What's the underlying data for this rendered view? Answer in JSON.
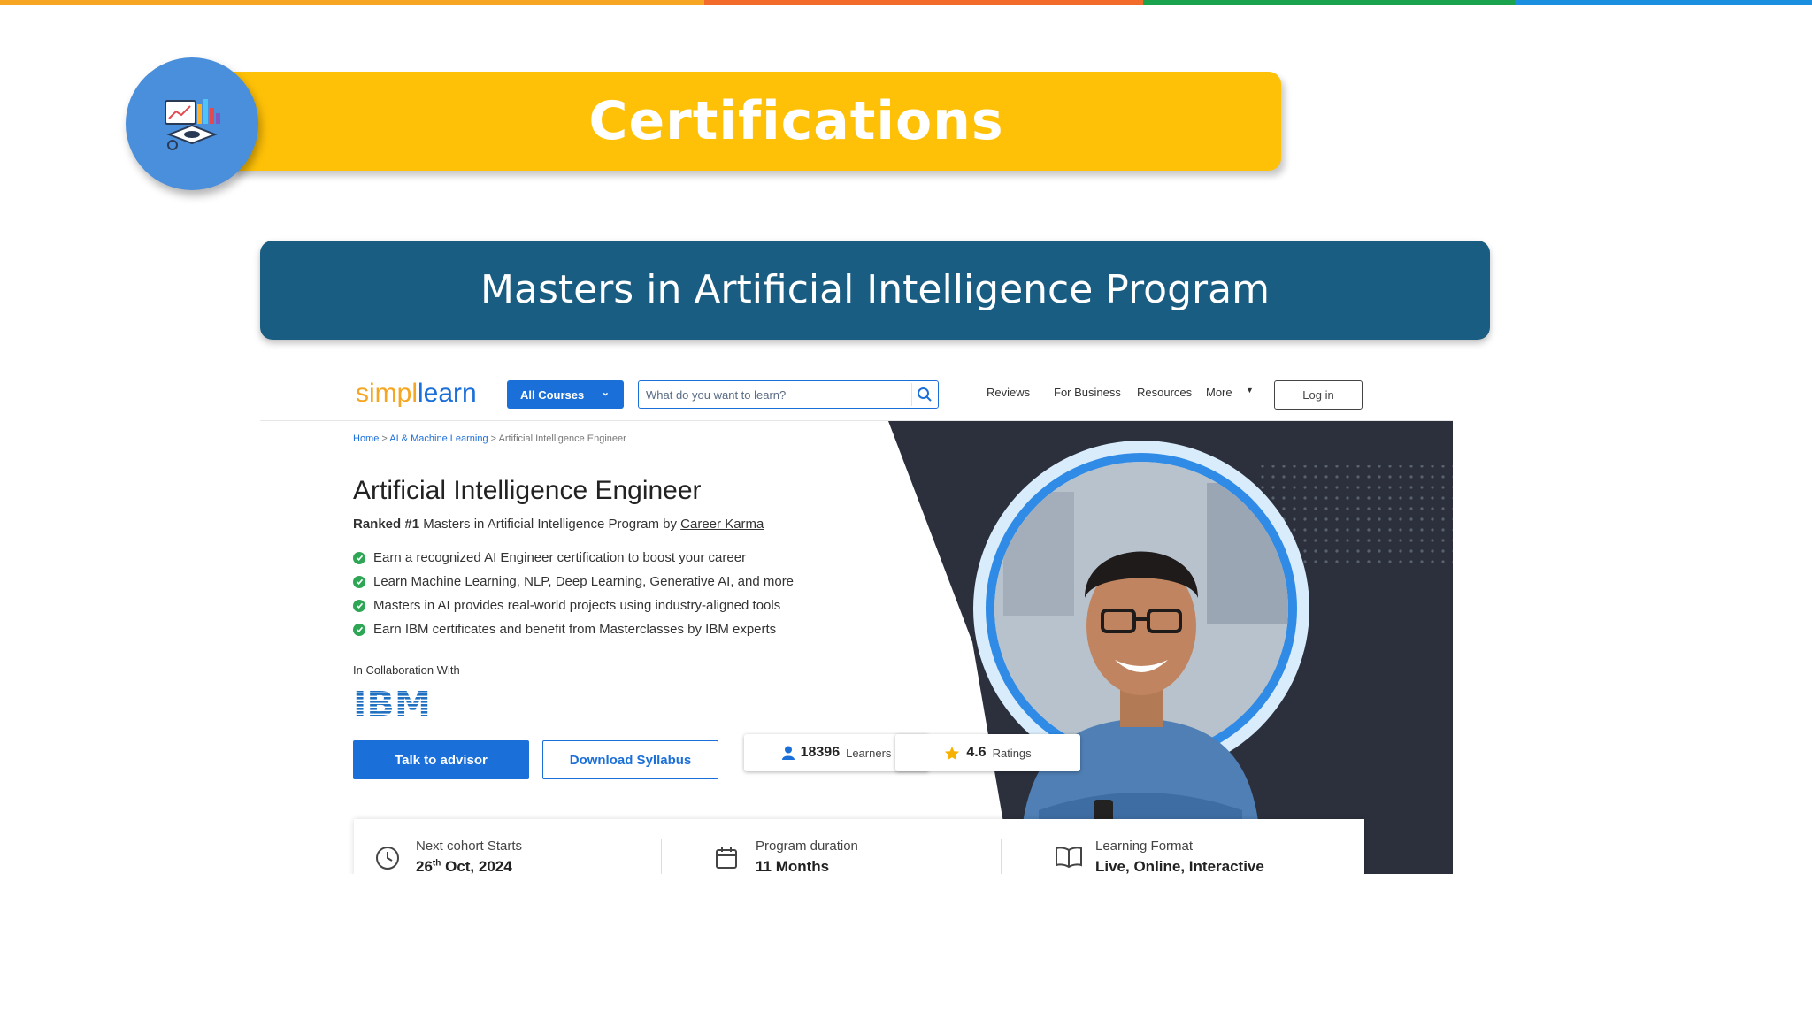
{
  "colors": {
    "strip": [
      "#f6a623",
      "#f26b2a",
      "#1aa24d",
      "#1a8fe0"
    ],
    "banner": "#ffc107",
    "badge": "#4a8fdc",
    "program_bar": "#1a5d82",
    "primary_blue": "#1b6fd8",
    "hero_dark": "#2b303c",
    "check_green": "#2ea655"
  },
  "slide": {
    "title": "Certifications",
    "program_title": "Masters in Artificial Intelligence Program",
    "badge_icon": "analytics-dashboard-icon"
  },
  "site": {
    "logo_part1": "simpl",
    "logo_part2": "learn",
    "all_courses_label": "All Courses",
    "search_placeholder": "What do you want to learn?",
    "nav": {
      "reviews": "Reviews",
      "for_business": "For Business",
      "resources": "Resources",
      "more": "More"
    },
    "login_label": "Log in",
    "breadcrumb": {
      "home": "Home",
      "sep": " > ",
      "category": "AI & Machine Learning",
      "current": "Artificial Intelligence Engineer"
    },
    "course_title": "Artificial Intelligence Engineer",
    "ranked_prefix": "Ranked #1",
    "ranked_mid": " Masters in Artificial Intelligence Program by ",
    "ranked_link": "Career Karma",
    "bullets": [
      "Earn a recognized AI Engineer certification to boost your career",
      "Learn Machine Learning, NLP, Deep Learning, Generative AI, and more",
      "Masters in AI provides real-world projects using industry-aligned tools",
      "Earn IBM certificates and benefit from Masterclasses by IBM experts"
    ],
    "collab_label": "In Collaboration With",
    "partner_logo": "IBM",
    "talk_label": "Talk to advisor",
    "download_label": "Download Syllabus",
    "learners_count": "18396",
    "learners_label": "Learners",
    "rating_value": "4.6",
    "rating_label": "Ratings",
    "info": {
      "cohort_label": "Next cohort Starts",
      "cohort_day": "26",
      "cohort_suffix": "th",
      "cohort_rest": " Oct, 2024",
      "duration_label": "Program duration",
      "duration_value": "11 Months",
      "format_label": "Learning Format",
      "format_value": "Live, Online, Interactive"
    }
  }
}
